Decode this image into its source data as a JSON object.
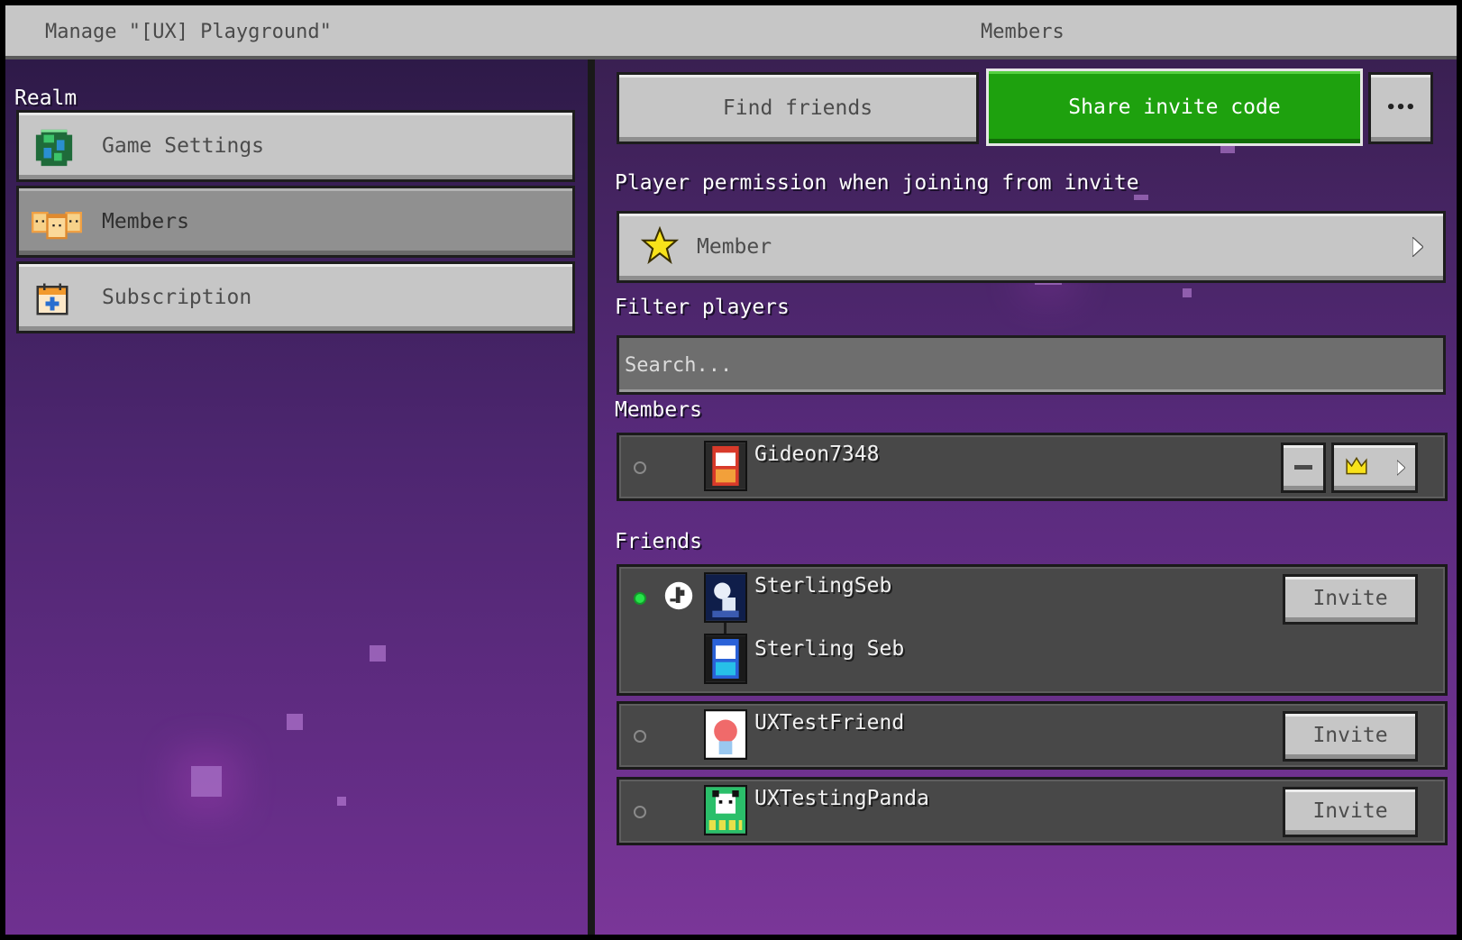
{
  "header": {
    "title": "Manage \"[UX] Playground\"",
    "page_title": "Members"
  },
  "sidebar": {
    "section_label": "Realm",
    "items": [
      {
        "label": "Game Settings",
        "icon": "globe-icon",
        "selected": false
      },
      {
        "label": "Members",
        "icon": "members-icon",
        "selected": true
      },
      {
        "label": "Subscription",
        "icon": "calendar-plus-icon",
        "selected": false
      }
    ]
  },
  "actions": {
    "find_friends": "Find friends",
    "share_invite": "Share invite code",
    "more": "•••"
  },
  "permission": {
    "label": "Player permission when joining from invite",
    "value": "Member",
    "icon": "star-icon"
  },
  "filter": {
    "label": "Filter players",
    "placeholder": "Search..."
  },
  "members": {
    "label": "Members",
    "list": [
      {
        "name": "Gideon7348",
        "online": false,
        "role_icon": "crown-icon"
      }
    ]
  },
  "friends": {
    "label": "Friends",
    "invite_label": "Invite",
    "list": [
      {
        "name": "SterlingSeb",
        "linked_name": "Sterling Seb",
        "online": true,
        "platform_icon": "playstation-icon"
      },
      {
        "name": "UXTestFriend",
        "online": false
      },
      {
        "name": "UXTestingPanda",
        "online": false
      }
    ]
  },
  "colors": {
    "accent_green": "#1ea10e",
    "online_green": "#27e34a",
    "button_gray": "#c6c6c6",
    "row_dark": "#484848"
  }
}
